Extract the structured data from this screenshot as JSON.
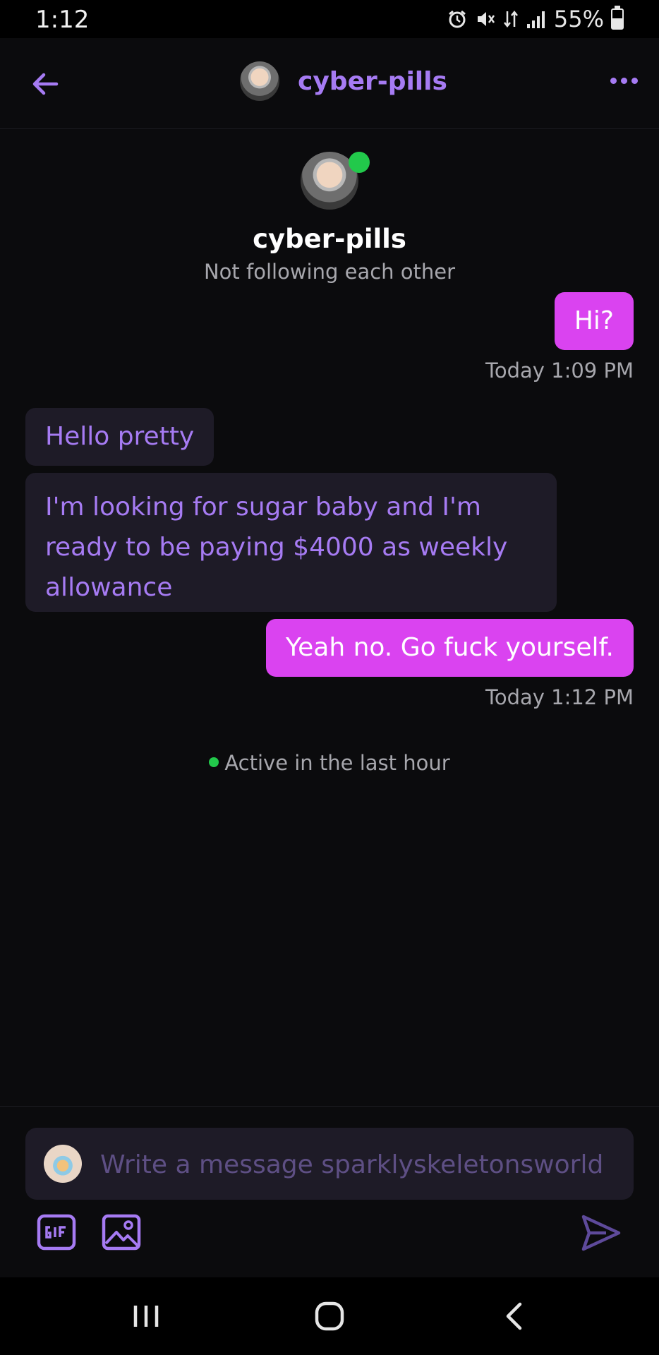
{
  "status_bar": {
    "time": "1:12",
    "battery_percent": "55%",
    "battery_level": 0.55,
    "icons": [
      "alarm-icon",
      "mute-icon",
      "data-icon",
      "signal-icon",
      "battery-icon"
    ]
  },
  "header": {
    "username": "cyber-pills",
    "back_icon": "arrow-left-icon",
    "more_icon": "more-horizontal-icon"
  },
  "profile": {
    "name": "cyber-pills",
    "relationship": "Not following each other",
    "online": true
  },
  "messages": [
    {
      "direction": "sent",
      "text": "Hi?",
      "timestamp": "Today 1:09 PM"
    },
    {
      "direction": "received",
      "text": "Hello pretty"
    },
    {
      "direction": "received",
      "lines": [
        "I'm looking for sugar baby and I'm",
        "ready to be paying $4000 as weekly",
        "allowance"
      ]
    },
    {
      "direction": "sent",
      "text": "Yeah no. Go fuck yourself.",
      "timestamp": "Today 1:12 PM"
    }
  ],
  "activity": {
    "text": "Active in the last hour"
  },
  "composer": {
    "placeholder": "Write a message sparklyskeletonsworld",
    "value": "",
    "tools": [
      "gif-icon",
      "image-icon"
    ],
    "send_icon": "send-icon"
  },
  "nav_bar": {
    "icons": [
      "recent-apps-icon",
      "home-icon",
      "back-icon"
    ]
  },
  "colors": {
    "accent": "#a67bf3",
    "sent_bubble": "#da43f0",
    "received_bubble": "#1e1b27",
    "background": "#0b0b0d",
    "online": "#22c94b"
  }
}
